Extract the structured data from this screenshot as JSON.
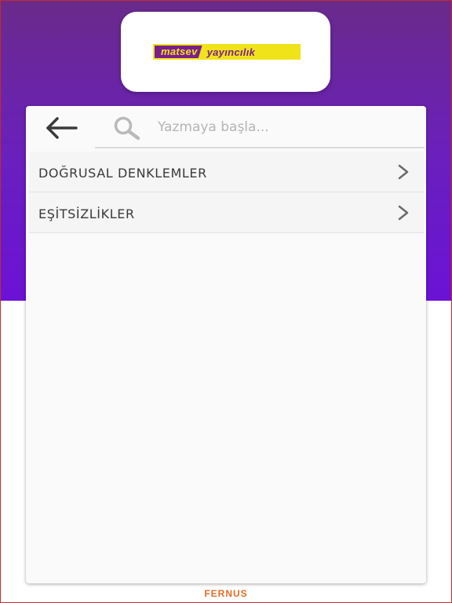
{
  "brand": {
    "logo_part1": "matsev",
    "logo_part2": "yayıncılık",
    "colors": {
      "purple": "#7a1f8c",
      "yellow": "#f1e31a",
      "header_gradient_end": "#6b12d6"
    }
  },
  "toolbar": {
    "back_icon": "arrow-left-icon",
    "search_icon": "search-icon",
    "search_placeholder": "Yazmaya başla..."
  },
  "list": {
    "items": [
      {
        "label": "DOĞRUSAL DENKLEMLER",
        "icon": "chevron-right-icon"
      },
      {
        "label": "EŞİTSİZLİKLER",
        "icon": "chevron-right-icon"
      }
    ]
  },
  "footer": {
    "text": "FERNUS",
    "color": "#e36b27"
  }
}
